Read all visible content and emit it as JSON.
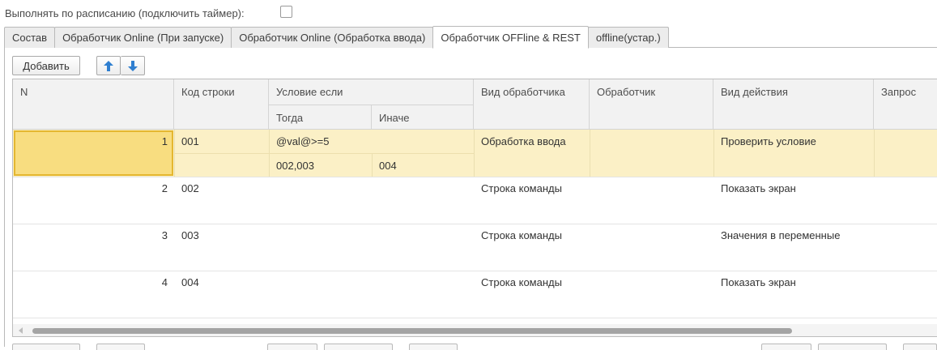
{
  "schedule": {
    "label": "Выполнять по расписанию (подключить таймер):",
    "checked": false
  },
  "tabs": [
    {
      "label": "Состав",
      "active": false
    },
    {
      "label": "Обработчик Online (При запуске)",
      "active": false
    },
    {
      "label": "Обработчик Online (Обработка ввода)",
      "active": false
    },
    {
      "label": "Обработчик OFFline & REST",
      "active": true
    },
    {
      "label": "offline(устар.)",
      "active": false
    }
  ],
  "toolbar": {
    "add_label": "Добавить",
    "up_icon": "arrow-up-icon",
    "down_icon": "arrow-down-icon"
  },
  "table": {
    "headers": {
      "n": "N",
      "code": "Код строки",
      "condition": "Условие если",
      "then": "Тогда",
      "else": "Иначе",
      "handler_type": "Вид обработчика",
      "handler": "Обработчик",
      "action": "Вид действия",
      "query": "Запрос"
    },
    "rows": [
      {
        "n": "1",
        "code": "001",
        "condition": "@val@>=5",
        "then": "002,003",
        "else": "004",
        "handler_type": "Обработка ввода",
        "handler": "",
        "action": "Проверить условие",
        "query": ""
      },
      {
        "n": "2",
        "code": "002",
        "condition": "",
        "then": "",
        "else": "",
        "handler_type": "Строка команды",
        "handler": "",
        "action": "Показать экран",
        "query": ""
      },
      {
        "n": "3",
        "code": "003",
        "condition": "",
        "then": "",
        "else": "",
        "handler_type": "Строка команды",
        "handler": "",
        "action": "Значения в переменные",
        "query": ""
      },
      {
        "n": "4",
        "code": "004",
        "condition": "",
        "then": "",
        "else": "",
        "handler_type": "Строка команды",
        "handler": "",
        "action": "Показать экран",
        "query": ""
      }
    ]
  },
  "colors": {
    "selected_row": "#fbf0c6",
    "focused_cell": "#f8dd80",
    "arrow": "#2f7fd0"
  }
}
